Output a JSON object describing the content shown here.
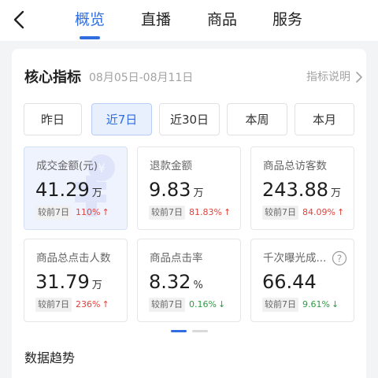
{
  "header": {
    "tabs": [
      {
        "label": "概览",
        "active": true
      },
      {
        "label": "直播",
        "active": false
      },
      {
        "label": "商品",
        "active": false
      },
      {
        "label": "服务",
        "active": false
      }
    ],
    "accent_color": "#2f6de0"
  },
  "section": {
    "title": "核心指标",
    "date_range": "08月05日-08月11日",
    "help_link": "指标说明"
  },
  "periods": [
    {
      "label": "昨日",
      "active": false
    },
    {
      "label": "近7日",
      "active": true
    },
    {
      "label": "近30日",
      "active": false
    },
    {
      "label": "本周",
      "active": false
    },
    {
      "label": "本月",
      "active": false
    }
  ],
  "metrics": [
    {
      "label": "成交金额(元)",
      "value": "41.29",
      "unit": "万",
      "compare_label": "较前7日",
      "change": "110%",
      "direction": "up",
      "active": true
    },
    {
      "label": "退款金额",
      "value": "9.83",
      "unit": "万",
      "compare_label": "较前7日",
      "change": "81.83%",
      "direction": "up",
      "active": false
    },
    {
      "label": "商品总访客数",
      "value": "243.88",
      "unit": "万",
      "compare_label": "较前7日",
      "change": "84.09%",
      "direction": "up",
      "active": false
    },
    {
      "label": "商品总点击人数",
      "value": "31.79",
      "unit": "万",
      "compare_label": "较前7日",
      "change": "236%",
      "direction": "up",
      "active": false
    },
    {
      "label": "商品点击率",
      "value": "8.32",
      "unit": "%",
      "compare_label": "较前7日",
      "change": "0.16%",
      "direction": "down",
      "active": false
    },
    {
      "label": "千次曝光成...",
      "value": "66.44",
      "unit": "",
      "compare_label": "较前7日",
      "change": "9.61%",
      "direction": "down",
      "active": false
    }
  ],
  "pager": {
    "current": 1,
    "total": 2
  },
  "trend": {
    "title": "数据趋势"
  },
  "arrows": {
    "up": "↑",
    "down": "↓"
  }
}
